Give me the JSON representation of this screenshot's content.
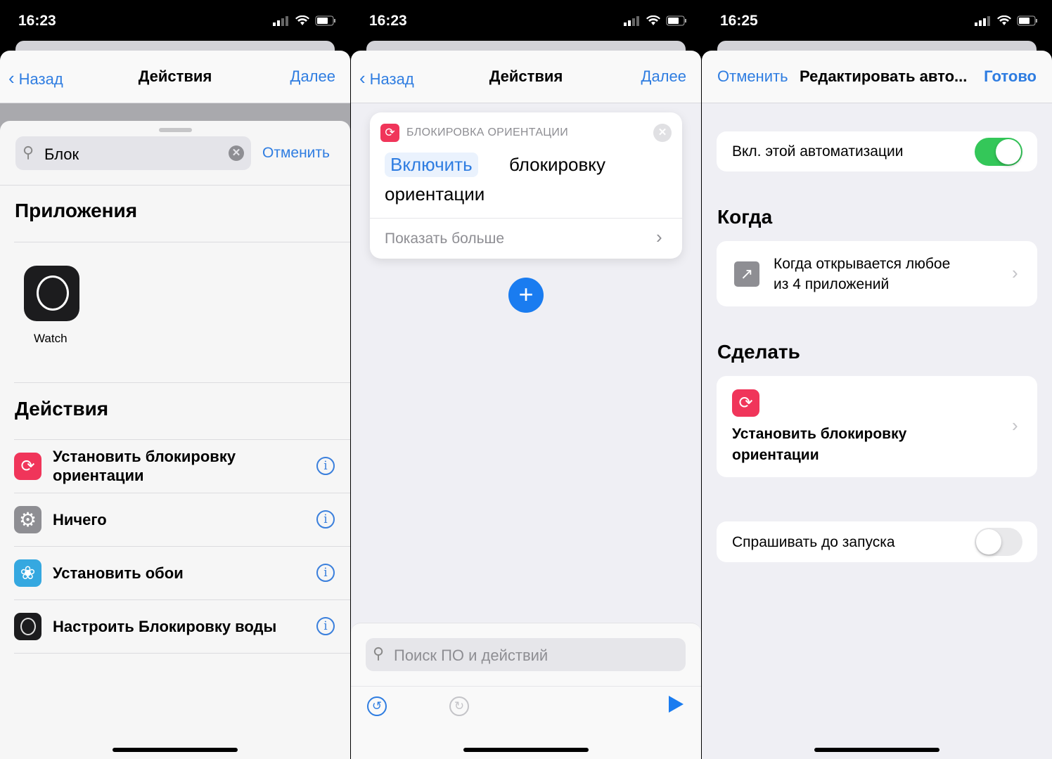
{
  "status_bars": [
    {
      "time": "16:23"
    },
    {
      "time": "16:23"
    },
    {
      "time": "16:25"
    }
  ],
  "panel1": {
    "nav": {
      "back": "Назад",
      "title": "Действия",
      "next": "Далее"
    },
    "search": {
      "value": "Блок",
      "cancel": "Отменить"
    },
    "apps_heading": "Приложения",
    "apps": [
      {
        "label": "Watch",
        "icon": "watch-icon"
      }
    ],
    "actions_heading": "Действия",
    "actions": [
      {
        "line1": "Установить блокировку",
        "line2": "ориентации",
        "icon": "orientation-lock-icon",
        "color": "#f0355a"
      },
      {
        "line1": "Ничего",
        "line2": "",
        "icon": "gear-icon",
        "color": "#8e8e93"
      },
      {
        "line1": "Установить обои",
        "line2": "",
        "icon": "flower-icon",
        "color": "#35a8e0"
      },
      {
        "line1": "Настроить Блокировку воды",
        "line2": "",
        "icon": "watch-icon",
        "color": "#1c1c1e"
      }
    ]
  },
  "panel2": {
    "nav": {
      "back": "Назад",
      "title": "Действия",
      "next": "Далее"
    },
    "action_card": {
      "header": "БЛОКИРОВКА ОРИЕНТАЦИИ",
      "param": "Включить",
      "text1": "блокировку",
      "text2": "ориентации",
      "show_more": "Показать больше"
    },
    "search": {
      "placeholder": "Поиск ПО и действий"
    }
  },
  "panel3": {
    "nav": {
      "cancel": "Отменить",
      "title": "Редактировать авто...",
      "done": "Готово"
    },
    "enable": {
      "label": "Вкл. этой автоматизации",
      "on": true
    },
    "when_heading": "Когда",
    "when": {
      "line1": "Когда открывается любое",
      "line2": "из 4 приложений"
    },
    "do_heading": "Сделать",
    "do": {
      "line1": "Установить блокировку",
      "line2": "ориентации"
    },
    "ask": {
      "label": "Спрашивать до запуска",
      "on": false
    }
  },
  "colors": {
    "accent": "#2f7de1",
    "toggle_on": "#34c759",
    "action_red": "#f0355a"
  }
}
